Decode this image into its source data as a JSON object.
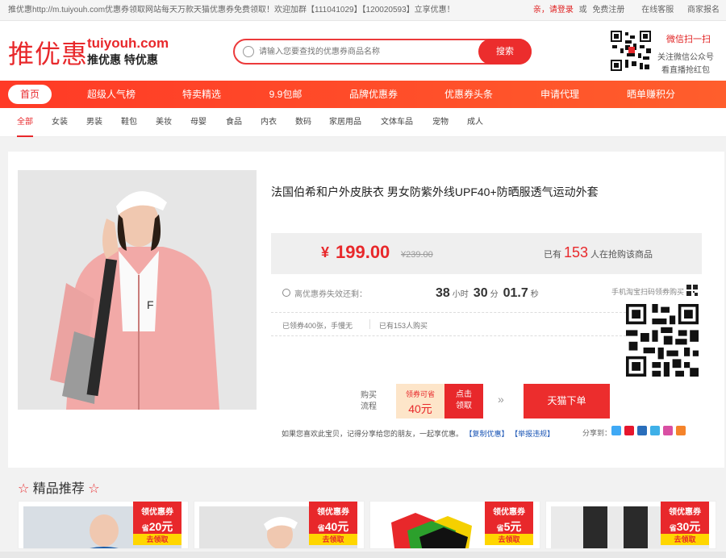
{
  "topbar": {
    "notice": "推优惠http://m.tuiyouh.com优惠券领取网站每天万款天猫优惠券免费领取！欢迎加群【111041029】【120020593】立享优惠！",
    "greeting": "亲，请登录",
    "or": "或",
    "register": "免费注册",
    "service": "在线客服",
    "merchant": "商家报名"
  },
  "header": {
    "logo_cn": "推优惠",
    "logo_en": "tuiyouh.com",
    "slogan": "推优惠 特优惠",
    "search_placeholder": "请输入您要查找的优惠券商品名称",
    "search_button": "搜索",
    "wechat_scan": "微信扫一扫",
    "wechat_follow": "关注微信公众号",
    "wechat_live": "看直播抢红包"
  },
  "nav": [
    {
      "label": "首页"
    },
    {
      "label": "超级人气榜"
    },
    {
      "label": "特卖精选"
    },
    {
      "label": "9.9包邮"
    },
    {
      "label": "品牌优惠券"
    },
    {
      "label": "优惠券头条"
    },
    {
      "label": "申请代理"
    },
    {
      "label": "晒单赚积分"
    }
  ],
  "categories": [
    "全部",
    "女装",
    "男装",
    "鞋包",
    "美妆",
    "母婴",
    "食品",
    "内衣",
    "数码",
    "家居用品",
    "文体车品",
    "宠物",
    "成人"
  ],
  "product": {
    "title": "法国伯希和户外皮肤衣 男女防紫外线UPF40+防晒服透气运动外套",
    "currency": "¥",
    "price": "199.00",
    "original_price": "¥239.00",
    "buyers_prefix": "已有",
    "buyers_count": "153",
    "buyers_suffix": "人在抢购该商品",
    "countdown_label": "离优惠券失效还剩：",
    "countdown": {
      "hours": "38",
      "hours_unit": "小时",
      "minutes": "30",
      "minutes_unit": "分",
      "seconds": "01.7",
      "seconds_unit": "秒"
    },
    "coupons_claimed": "已领券400张，手慢无",
    "bought": "已有153人购买",
    "mobile_tip": "手机淘宝扫码领券购买",
    "flow_label": "购买流程",
    "coupon_label": "领券可省",
    "coupon_value": "40元",
    "claim_button": "点击领取",
    "flow_arrows": "»",
    "tmall_button": "天猫下单",
    "share_tip": "如果您喜欢此宝贝，记得分享给您的朋友，一起享优惠。",
    "copy_link": "【复制优惠】",
    "report_link": "【举报违规】",
    "share_label": "分享到："
  },
  "recommend": {
    "title": "精品推荐",
    "items": [
      {
        "badge_title": "领优惠券",
        "save_prefix": "省",
        "save_amount": "20元",
        "badge_action": "去领取"
      },
      {
        "badge_title": "领优惠券",
        "save_prefix": "省",
        "save_amount": "40元",
        "badge_action": "去领取"
      },
      {
        "badge_title": "领优惠券",
        "save_prefix": "省",
        "save_amount": "5元",
        "badge_action": "去领取"
      },
      {
        "badge_title": "领优惠券",
        "save_prefix": "省",
        "save_amount": "30元",
        "badge_action": "去领取"
      }
    ]
  },
  "colors": {
    "accent": "#e8282b",
    "nav_gradient_start": "#ff3a26",
    "coupon_bg": "#fde5c9",
    "badge_yellow": "#ffd600"
  },
  "icons": [
    "search-icon",
    "clock-icon",
    "qr-code-icon",
    "star-icon",
    "share-icons"
  ]
}
